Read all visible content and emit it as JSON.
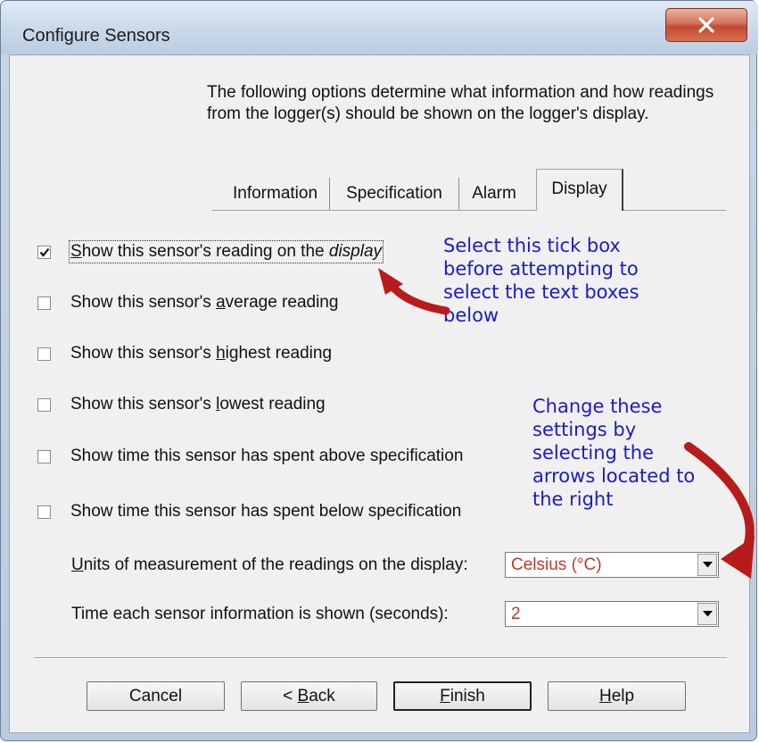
{
  "window": {
    "title": "Configure Sensors"
  },
  "intro_text": "The following options determine what information and how readings from the logger(s) should be shown on the logger's display.",
  "tabs": [
    {
      "label": "Information"
    },
    {
      "label": "Specification"
    },
    {
      "label": "Alarm"
    },
    {
      "label": "Display",
      "active": true
    }
  ],
  "options": {
    "reading_on_display": {
      "label_pre": "S",
      "label_mid": "how this sensor's reading on the ",
      "label_em": "display",
      "checked": true
    },
    "average": {
      "label_pre": "Show this sensor's ",
      "label_u": "a",
      "label_post": "verage reading",
      "checked": false
    },
    "highest": {
      "label_pre": "Show this sensor's ",
      "label_u": "h",
      "label_post": "ighest reading",
      "checked": false
    },
    "lowest": {
      "label_pre": "Show this sensor's ",
      "label_u": "l",
      "label_post": "owest reading",
      "checked": false
    },
    "above_spec": {
      "label": "Show time this sensor has spent above specification",
      "checked": false
    },
    "below_spec": {
      "label": "Show time this sensor has spent below specification",
      "checked": false
    }
  },
  "units": {
    "label_u": "U",
    "label_rest": "nits of measurement of the readings on the display:",
    "value": "Celsius (°C)"
  },
  "duration": {
    "label": "Time each sensor information is shown (seconds):",
    "value": "2"
  },
  "buttons": {
    "cancel": "Cancel",
    "back_pre": "< ",
    "back_u": "B",
    "back_post": "ack",
    "finish_u": "F",
    "finish_post": "inish",
    "help_u": "H",
    "help_post": "elp"
  },
  "annotations": {
    "tick_box_note": [
      "Select this tick box",
      "before attempting to",
      "select the text boxes",
      "below"
    ],
    "settings_note": [
      "Change these",
      "settings by",
      "selecting the",
      "arrows located to",
      "the right"
    ]
  },
  "colors": {
    "annotation_text": "#1a1acd",
    "arrow": "#b81b1b",
    "dropdown_value": "#c0392b",
    "close_button": "#c24a31"
  }
}
